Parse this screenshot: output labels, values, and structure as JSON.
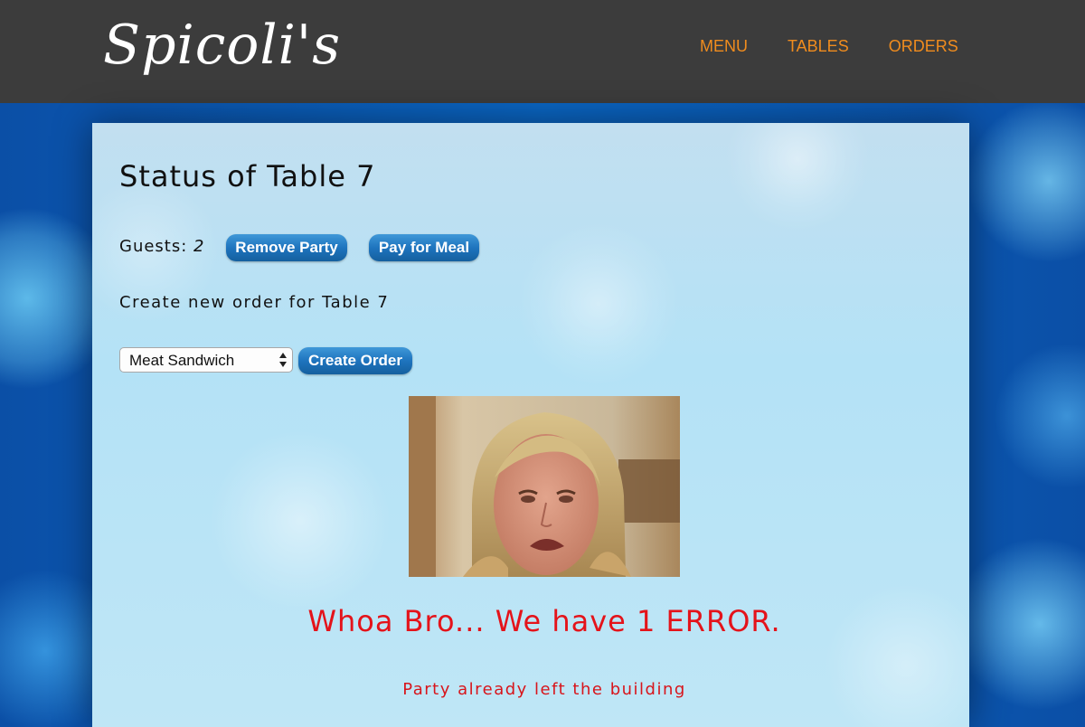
{
  "header": {
    "logo_text": "Spicoli's",
    "nav": [
      {
        "label": "MENU"
      },
      {
        "label": "TABLES"
      },
      {
        "label": "ORDERS"
      }
    ],
    "nav_color": "#f08c1e",
    "background_color": "#3c3c3c"
  },
  "main": {
    "title": "Status of Table 7",
    "guests_label": "Guests:",
    "guests_count": "2",
    "remove_party_label": "Remove Party",
    "pay_for_meal_label": "Pay for Meal",
    "create_order_heading": "Create new order for Table 7",
    "order_select_value": "Meat Sandwich",
    "create_order_label": "Create Order",
    "image_description_icon": "crying-surfer-photo",
    "error_title": "Whoa Bro... We have 1 ERROR.",
    "error_message": "Party already left the building",
    "error_color": "#e4131a",
    "button_color": "#1e74be"
  }
}
